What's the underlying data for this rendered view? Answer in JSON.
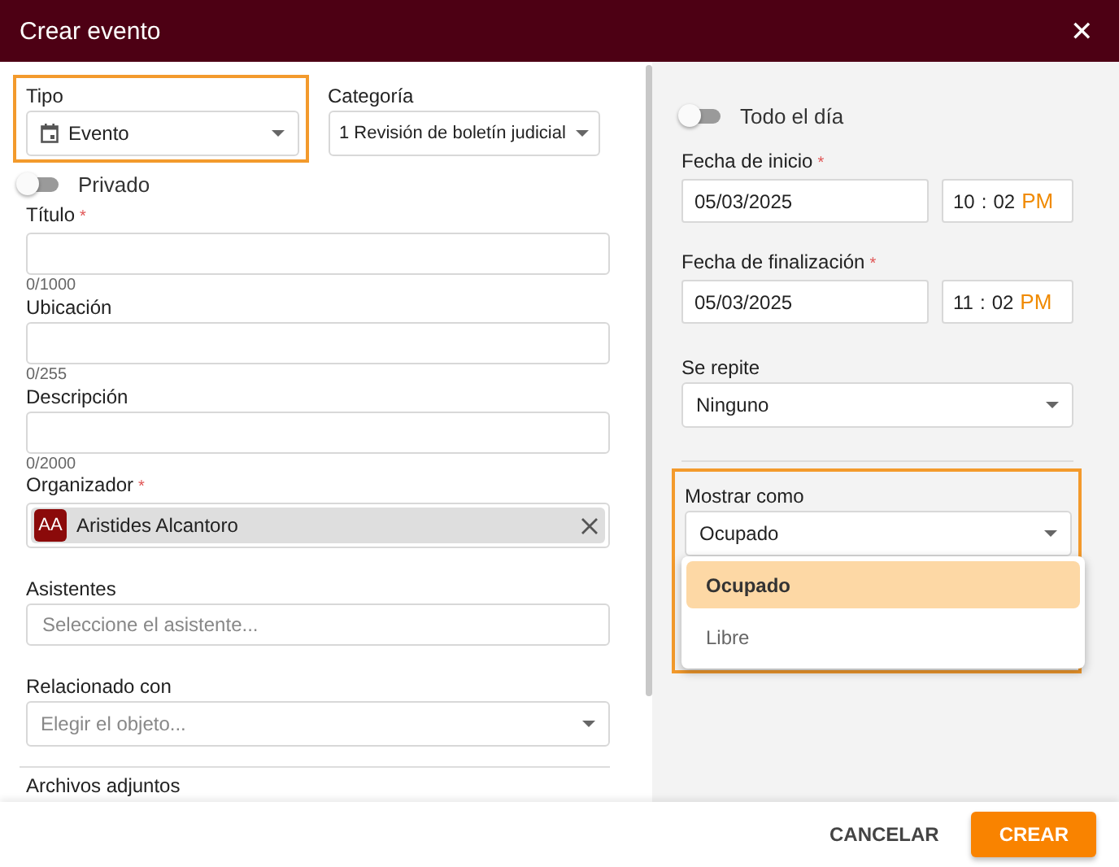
{
  "dialog": {
    "title": "Crear evento",
    "close": "✕"
  },
  "left": {
    "tipo": {
      "label": "Tipo",
      "value": "Evento",
      "highlighted": true
    },
    "categoria": {
      "label": "Categoría",
      "value": "1 Revisión de boletín judicial"
    },
    "privado": {
      "label": "Privado",
      "on": false
    },
    "fields": [
      {
        "kind": "text",
        "label": "Título",
        "required_mark": "*",
        "counter": "0/1000"
      },
      {
        "kind": "text",
        "label": "Ubicación",
        "counter": "0/255"
      },
      {
        "kind": "text",
        "label": "Descripción",
        "counter": "0/2000"
      },
      {
        "kind": "chip",
        "label": "Organizador",
        "required_mark": "*",
        "initials": "AA",
        "value": "Aristides Alcantoro"
      },
      {
        "kind": "text",
        "label": "Asistentes",
        "placeholder": "Seleccione el asistente..."
      },
      {
        "kind": "select",
        "label": "Relacionado con",
        "placeholder": "Elegir el objeto..."
      }
    ],
    "attachments": "Archivos adjuntos"
  },
  "right": {
    "todo_el_dia": {
      "label": "Todo el día",
      "on": false
    },
    "dates": [
      {
        "label": "Fecha de inicio",
        "required_mark": "*",
        "date": "05/03/2025",
        "hour": "10",
        "separator": ":",
        "minute": "02",
        "period": "PM"
      },
      {
        "label": "Fecha de finalización",
        "required_mark": "*",
        "date": "05/03/2025",
        "hour": "11",
        "separator": ":",
        "minute": "02",
        "period": "PM"
      }
    ],
    "se_repite": {
      "label": "Se repite",
      "value": "Ninguno"
    },
    "mostrar_como": {
      "label": "Mostrar como",
      "value": "Ocupado",
      "highlighted": true,
      "options": [
        {
          "label": "Ocupado",
          "selected": true
        },
        {
          "label": "Libre",
          "selected": false
        }
      ]
    }
  },
  "footer": {
    "buttons": [
      {
        "label": "CANCELAR",
        "kind": "text"
      },
      {
        "label": "CREAR",
        "kind": "primary"
      }
    ]
  }
}
